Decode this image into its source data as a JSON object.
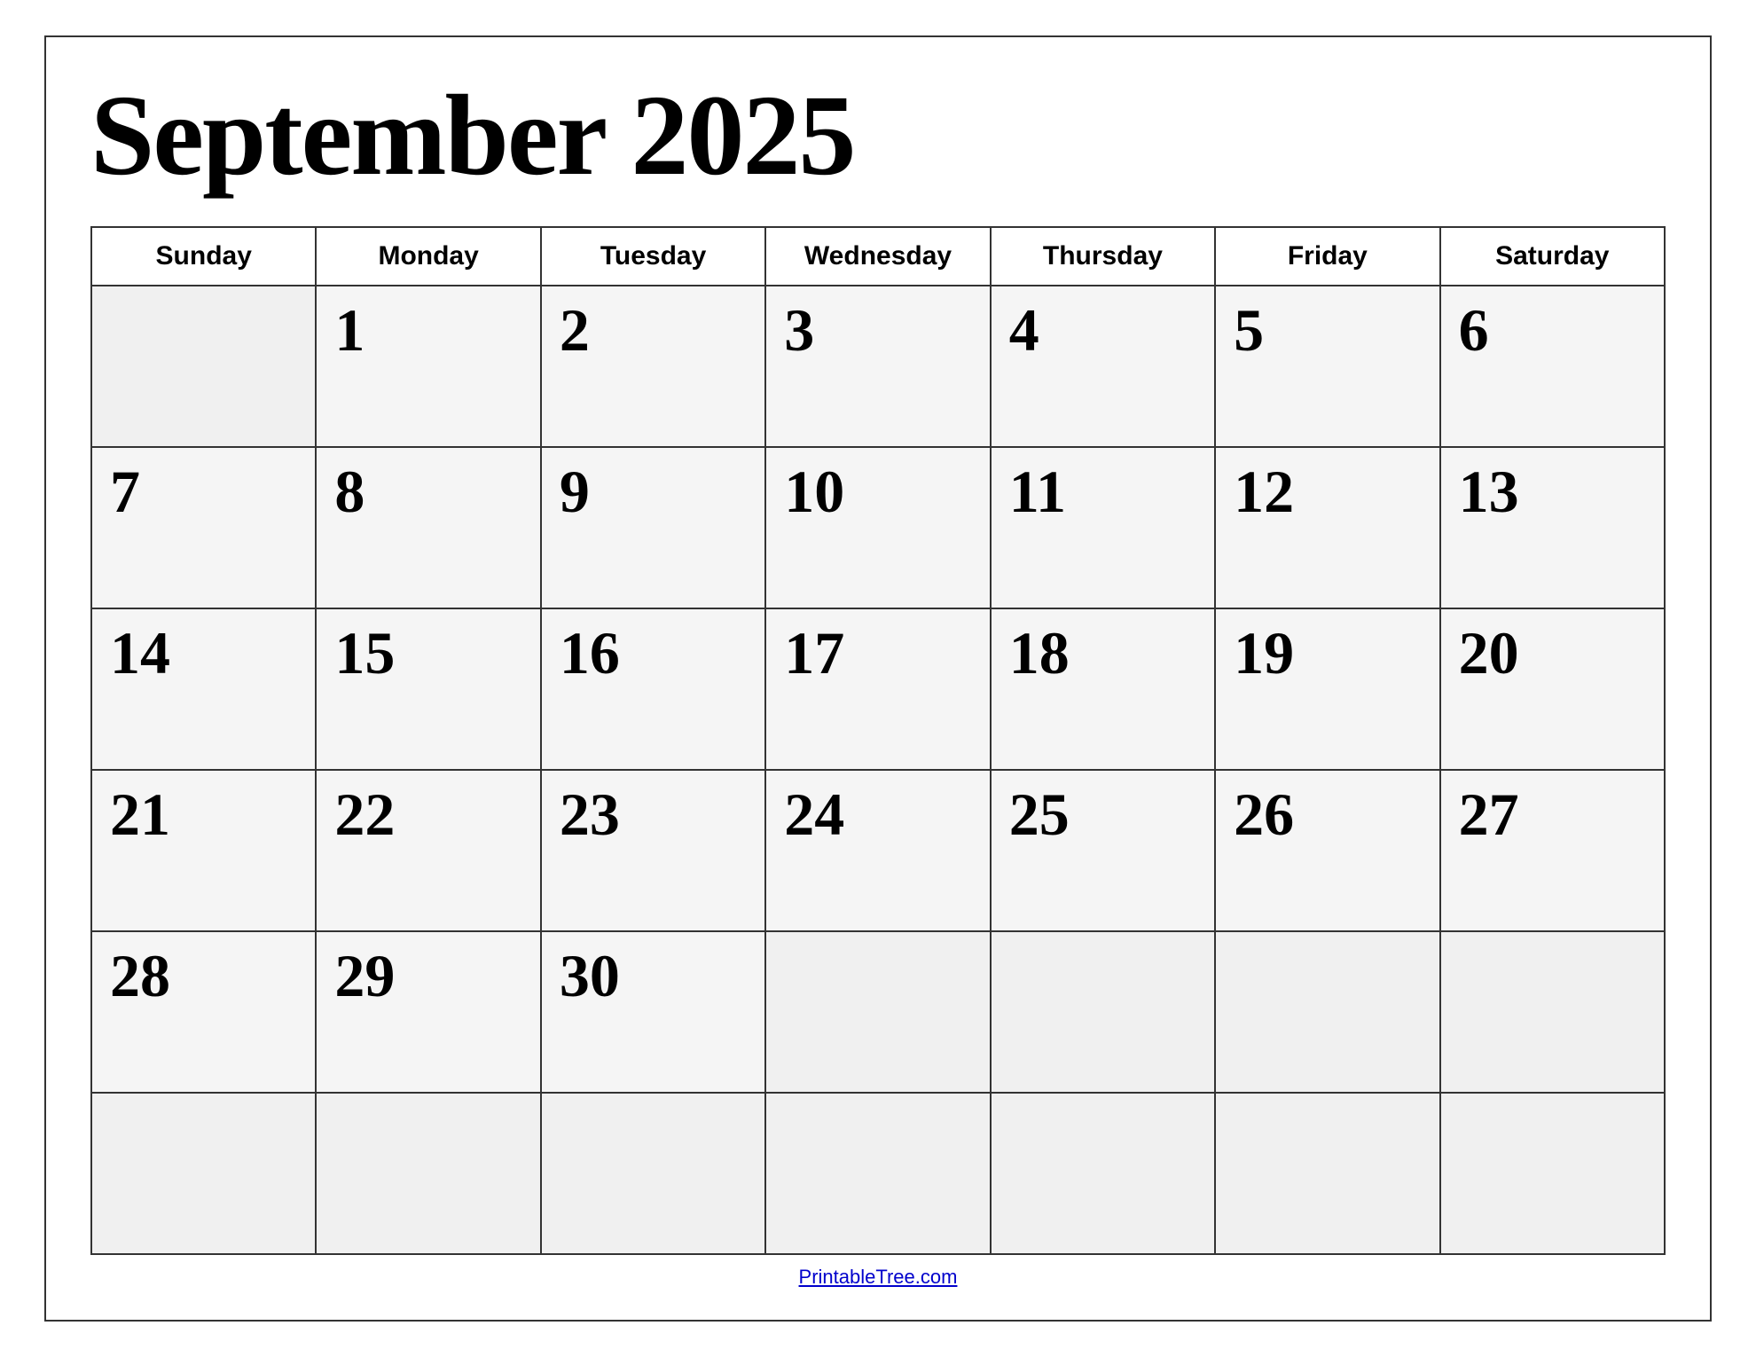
{
  "calendar": {
    "title": "September 2025",
    "days_of_week": [
      "Sunday",
      "Monday",
      "Tuesday",
      "Wednesday",
      "Thursday",
      "Friday",
      "Saturday"
    ],
    "weeks": [
      [
        null,
        "1",
        "2",
        "3",
        "4",
        "5",
        "6"
      ],
      [
        "7",
        "8",
        "9",
        "10",
        "11",
        "12",
        "13"
      ],
      [
        "14",
        "15",
        "16",
        "17",
        "18",
        "19",
        "20"
      ],
      [
        "21",
        "22",
        "23",
        "24",
        "25",
        "26",
        "27"
      ],
      [
        "28",
        "29",
        "30",
        null,
        null,
        null,
        null
      ],
      [
        null,
        null,
        null,
        null,
        null,
        null,
        null
      ]
    ],
    "footer_link_text": "PrintableTree.com",
    "footer_link_url": "https://PrintableTree.com"
  }
}
